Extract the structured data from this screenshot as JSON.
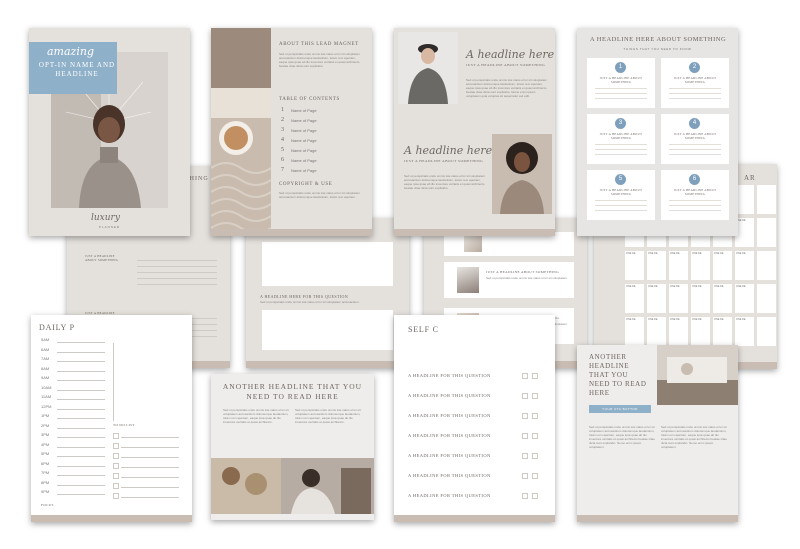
{
  "cover": {
    "script_word": "amazing",
    "headline": "OPT-IN NAME AND HEADLINE",
    "brand": "luxury",
    "brand_sub": "PLANNER",
    "accent": "#8fb0c9"
  },
  "about": {
    "title": "ABOUT THIS LEAD MAGNET",
    "toc_title": "TABLE OF CONTENTS",
    "toc": [
      {
        "num": "1",
        "label": "Name of Page"
      },
      {
        "num": "2",
        "label": "Name of Page"
      },
      {
        "num": "3",
        "label": "Name of Page"
      },
      {
        "num": "4",
        "label": "Name of Page"
      },
      {
        "num": "5",
        "label": "Name of Page"
      },
      {
        "num": "6",
        "label": "Name of Page"
      },
      {
        "num": "7",
        "label": "Name of Page"
      }
    ],
    "copyright": "COPYRIGHT & USE"
  },
  "headline_page": {
    "script": "A headline here",
    "sub": "JUST A HEADLINE ABOUT SOMETHING",
    "script2": "A headline here",
    "sub2": "JUST A HEADLINE ABOUT SOMETHING"
  },
  "steps_page": {
    "title": "A HEADLINE HERE ABOUT SOMETHING",
    "sub": "THINGS THAT YOU NEED TO KNOW",
    "steps": [
      {
        "num": "1",
        "label": "JUST A HEADLINE ABOUT SOMETHING"
      },
      {
        "num": "2",
        "label": "JUST A HEADLINE ABOUT SOMETHING"
      },
      {
        "num": "3",
        "label": "JUST A HEADLINE ABOUT SOMETHING"
      },
      {
        "num": "4",
        "label": "JUST A HEADLINE ABOUT SOMETHING"
      },
      {
        "num": "5",
        "label": "JUST A HEADLINE ABOUT SOMETHING"
      },
      {
        "num": "6",
        "label": "JUST A HEADLINE ABOUT SOMETHING"
      }
    ]
  },
  "middle_row": {
    "thing_label": "THING",
    "worksheet_items": [
      "JUST A HEADLINE ABOUT SOMETHING",
      "JUST A HEADLINE ABOUT SOMETHING"
    ],
    "question_title": "A HEADLINE HERE FOR THIS QUESTION",
    "list_items": [
      "JUST A HEADLINE ABOUT SOMETHING",
      "JUST A HEADLINE ABOUT SOMETHING"
    ],
    "calendar_label": "AR",
    "calendar_day_label": "ONE DE"
  },
  "daily": {
    "title": "DAILY P",
    "hours": [
      "5AM",
      "6AM",
      "7AM",
      "8AM",
      "9AM",
      "10AM",
      "11AM",
      "12PM",
      "1PM",
      "2PM",
      "3PM",
      "4PM",
      "5PM",
      "6PM",
      "7PM",
      "8PM",
      "9PM"
    ],
    "todo": "TO DO LIST",
    "focus": "FOCUS"
  },
  "another": {
    "title": "ANOTHER HEADLINE THAT YOU NEED TO READ HERE"
  },
  "self": {
    "title": "SELF C",
    "questions": [
      "A HEADLINE FOR THIS QUESTION",
      "A HEADLINE FOR THIS QUESTION",
      "A HEADLINE FOR THIS QUESTION",
      "A HEADLINE FOR THIS QUESTION",
      "A HEADLINE FOR THIS QUESTION",
      "A HEADLINE FOR THIS QUESTION",
      "A HEADLINE FOR THIS QUESTION"
    ]
  },
  "last": {
    "title": "ANOTHER HEADLINE THAT YOU NEED TO READ HERE",
    "button": "YOUR CTA BUTTON"
  }
}
